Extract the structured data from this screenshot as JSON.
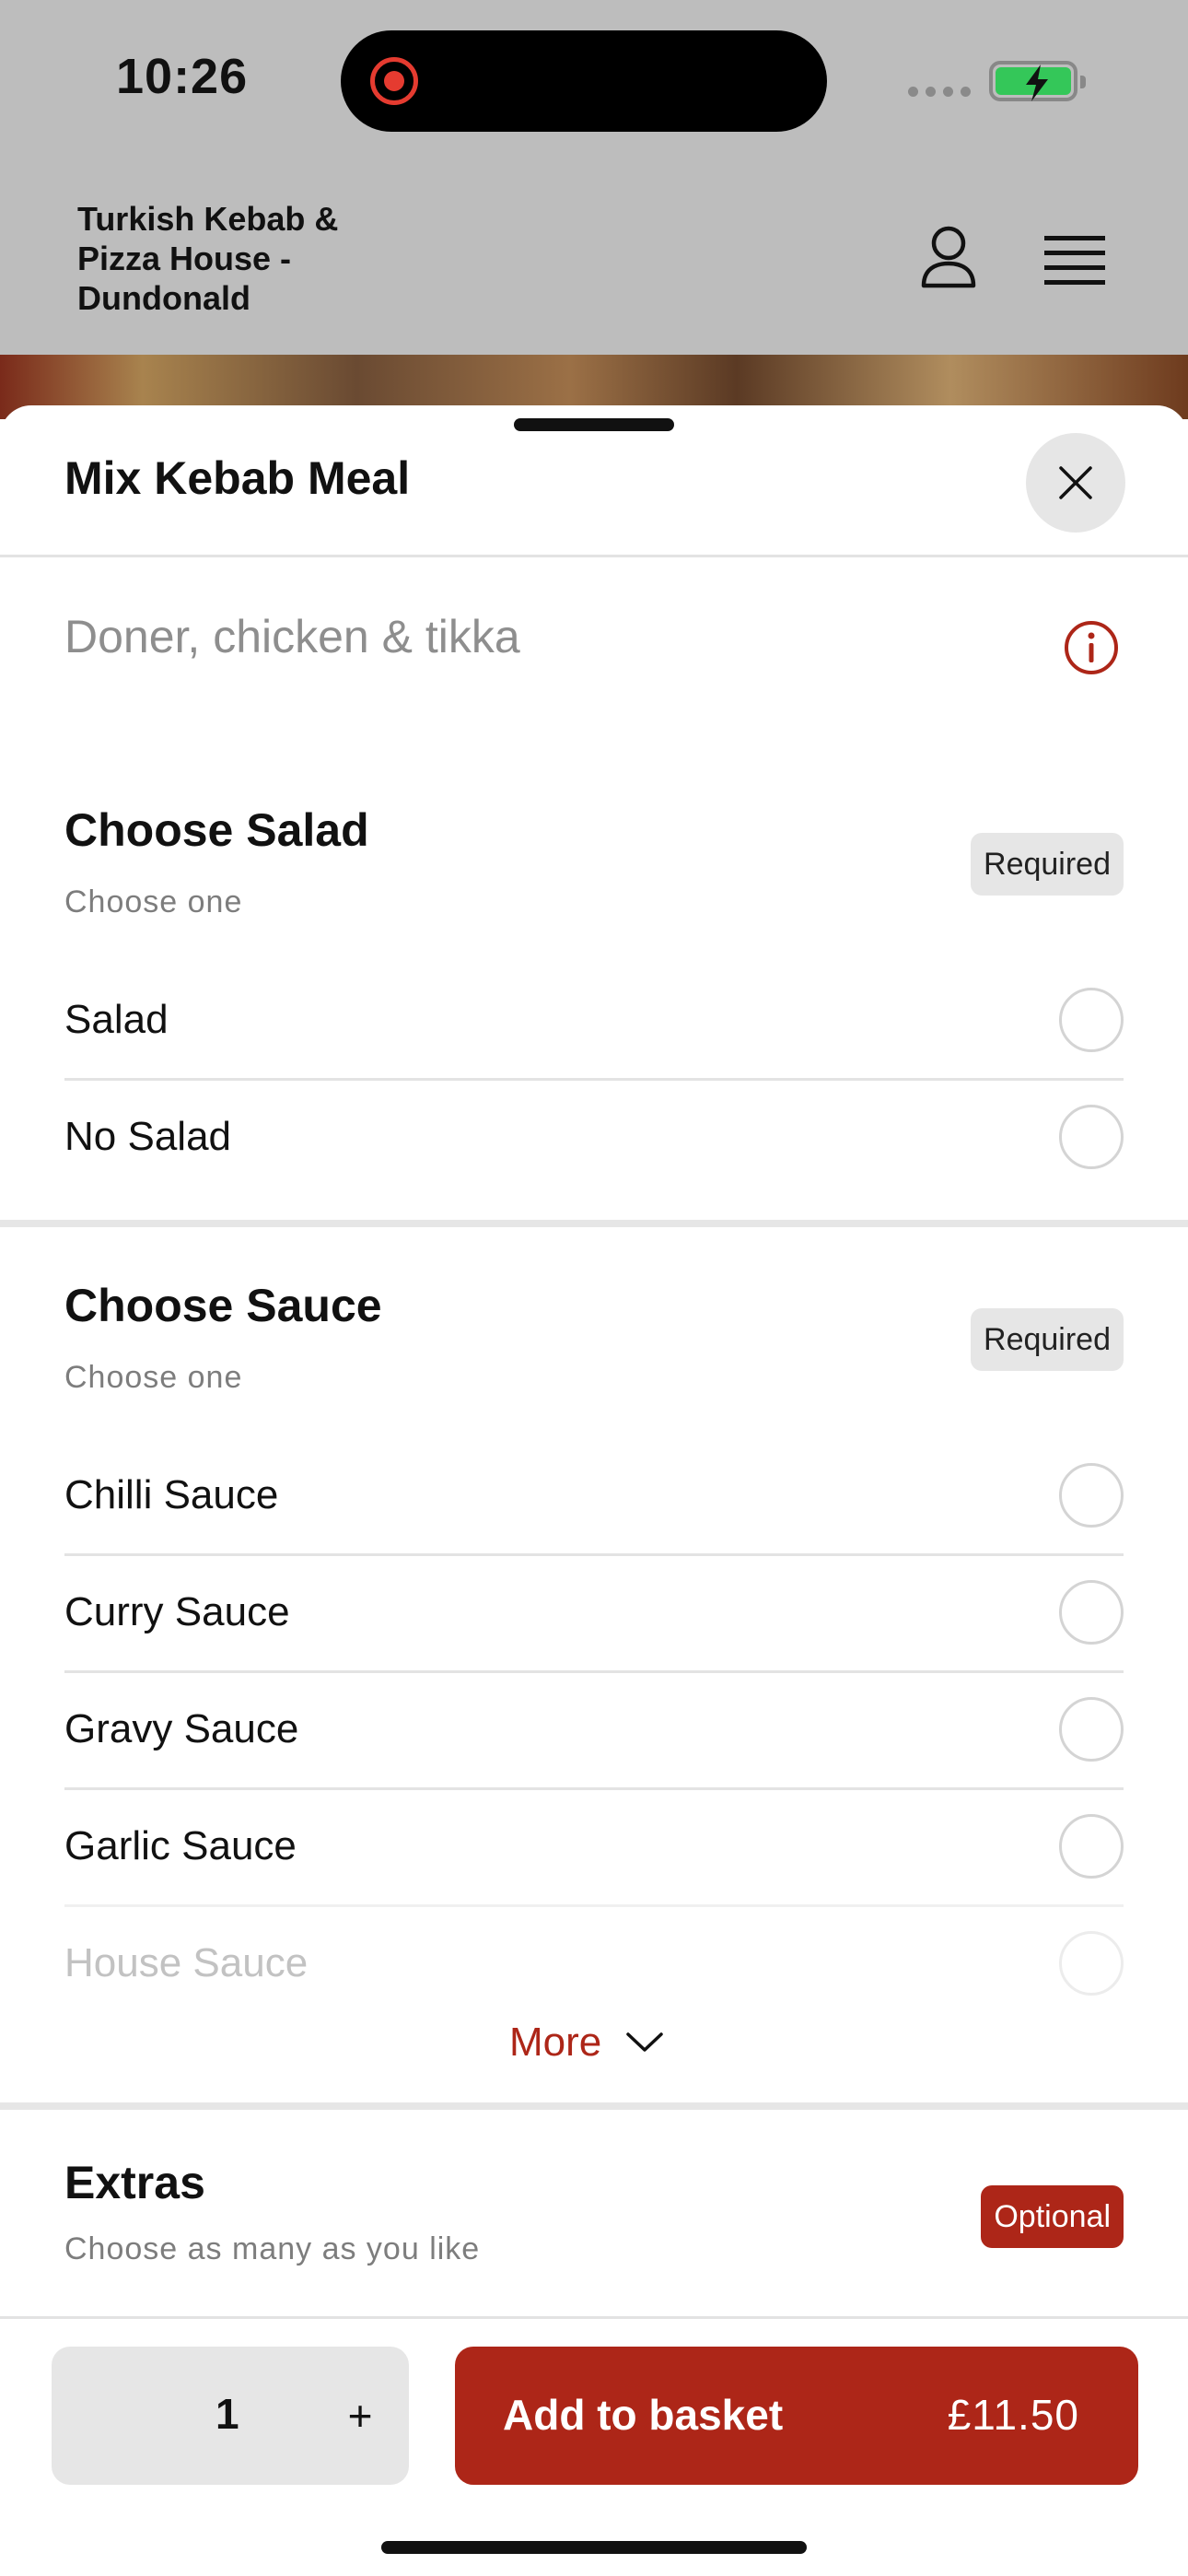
{
  "status_bar": {
    "time": "10:26"
  },
  "header": {
    "restaurant_name": "Turkish Kebab & Pizza House - Dundonald"
  },
  "item": {
    "title": "Mix Kebab Meal",
    "description": "Doner, chicken & tikka"
  },
  "sections": [
    {
      "title": "Choose Salad",
      "subtitle": "Choose one",
      "badge": "Required",
      "options": [
        "Salad",
        "No Salad"
      ]
    },
    {
      "title": "Choose Sauce",
      "subtitle": "Choose one",
      "badge": "Required",
      "options": [
        "Chilli Sauce",
        "Curry Sauce",
        "Gravy Sauce",
        "Garlic Sauce",
        "House Sauce"
      ],
      "more_label": "More"
    },
    {
      "title": "Extras",
      "subtitle": "Choose as many as you like",
      "badge": "Optional"
    }
  ],
  "footer": {
    "quantity": "1",
    "plus": "+",
    "add_label": "Add to basket",
    "price": "£11.50"
  },
  "colors": {
    "accent": "#ad2618",
    "header_bg": "#bdbdbd"
  },
  "icons": [
    "user-icon",
    "hamburger-menu-icon",
    "close-icon",
    "info-icon",
    "chevron-down-icon",
    "record-icon",
    "battery-charging-icon"
  ]
}
